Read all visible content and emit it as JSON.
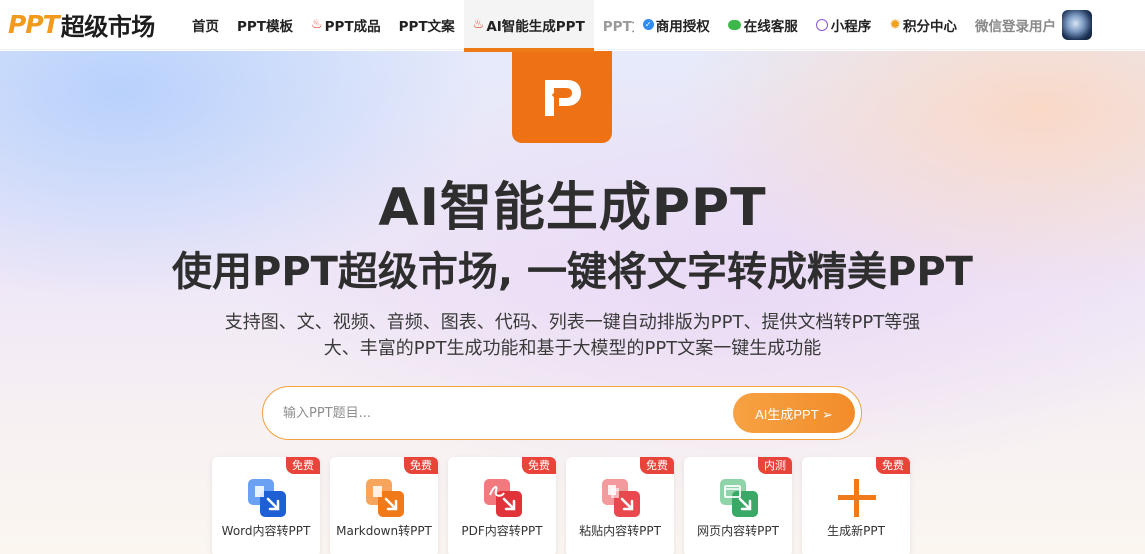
{
  "brand": {
    "logo_latin": "PPT",
    "logo_cn": "超级市场"
  },
  "nav": {
    "items": [
      {
        "label": "首页"
      },
      {
        "label": "PPT模板"
      },
      {
        "label": "PPT成品"
      },
      {
        "label": "PPT文案"
      },
      {
        "label": "AI智能生成PPT"
      },
      {
        "label": "PPT文"
      },
      {
        "label": "商用授权"
      },
      {
        "label": "在线客服"
      },
      {
        "label": "小程序"
      },
      {
        "label": "积分中心"
      }
    ],
    "login_label": "微信登录用户"
  },
  "hero": {
    "title": "AI智能生成PPT",
    "subtitle": "使用PPT超级市场, 一键将文字转成精美PPT",
    "description_line1": "支持图、文、视频、音频、图表、代码、列表一键自动排版为PPT、提供文档转PPT等强",
    "description_line2": "大、丰富的PPT生成功能和基于大模型的PPT文案一键生成功能"
  },
  "search": {
    "placeholder": "输入PPT题目...",
    "button_label": "AI生成PPT ➢"
  },
  "cards": [
    {
      "label": "Word内容转PPT",
      "badge": "免费",
      "icon": "word-convert-icon",
      "color": "#2f6fe0"
    },
    {
      "label": "Markdown转PPT",
      "badge": "免费",
      "icon": "markdown-convert-icon",
      "color": "#f07a1a"
    },
    {
      "label": "PDF内容转PPT",
      "badge": "免费",
      "icon": "pdf-convert-icon",
      "color": "#e0343a"
    },
    {
      "label": "粘贴内容转PPT",
      "badge": "免费",
      "icon": "paste-convert-icon",
      "color": "#e9484e"
    },
    {
      "label": "网页内容转PPT",
      "badge": "内测",
      "icon": "webpage-convert-icon",
      "color": "#3aa866"
    },
    {
      "label": "生成新PPT",
      "badge": "免费",
      "icon": "plus-icon",
      "color": "#f07a1a"
    }
  ],
  "colors": {
    "accent": "#ee7213",
    "button": "#f28c2a",
    "badge": "#e8443a"
  }
}
